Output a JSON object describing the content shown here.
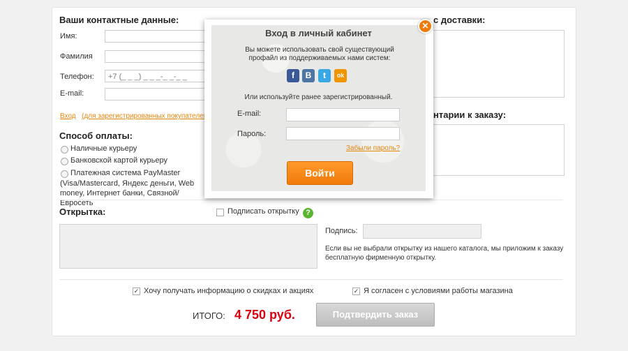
{
  "contacts": {
    "title": "Ваши контактные данные:",
    "name_label": "Имя:",
    "surname_label": "Фамилия",
    "phone_label": "Телефон:",
    "phone_placeholder": "+7 (_ _ _) _ _ _-_ _-_ _",
    "email_label": "E-mail:",
    "login_link": "Вход",
    "registered_note": "(для зарегистрированных покупателей)"
  },
  "delivery": {
    "title_partial": "с доставки:",
    "comments_partial": "нтарии к заказу:"
  },
  "payment": {
    "title": "Способ оплаты:",
    "options": [
      "Наличные курьеру",
      "Банковской картой курьеру",
      "Платежная система PayMaster"
    ],
    "paymaster_details": "(Visa/Mastercard, Яндекс деньги, Web money, Интернет банки, Связной/Евросеть"
  },
  "postcard": {
    "title": "Открытка:",
    "sign_checkbox_label": "Подписать открытку",
    "signature_label": "Подпись:",
    "note": "Если вы не выбрали открытку из нашего каталога, мы приложим к заказу бесплатную фирменную открытку."
  },
  "footer": {
    "subscribe_label": "Хочу получать информацию о скидках и акциях",
    "agree_label": "Я согласен с условиями работы магазина",
    "total_label": "ИТОГО:",
    "total_value": "4 750 руб.",
    "confirm_button": "Подтвердить заказ"
  },
  "modal": {
    "title": "Вход в личный кабинет",
    "intro": "Вы можете использовать свой существующий профайл из поддерживаемых нами систем:",
    "alt_text": "Или используйте ранее зарегистрированный.",
    "email_label": "E-mail:",
    "password_label": "Пароль:",
    "forgot_link": "Забыли пароль?",
    "login_button": "Войти",
    "social": [
      {
        "name": "facebook-icon",
        "glyph": "f",
        "color": "#3b5998"
      },
      {
        "name": "vk-icon",
        "glyph": "B",
        "color": "#4c75a3"
      },
      {
        "name": "twitter-icon",
        "glyph": "t",
        "color": "#3aa8e4"
      },
      {
        "name": "odnoklassniki-icon",
        "glyph": "ok",
        "color": "#f29400"
      }
    ]
  },
  "colors": {
    "accent": "#f07a0b",
    "total": "#d6000f",
    "help": "#5ab52e"
  }
}
